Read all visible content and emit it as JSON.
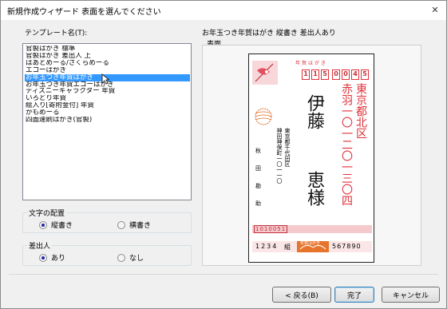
{
  "window": {
    "title": "新規作成ウィザード 表面を選んでください",
    "close_glyph": "✕"
  },
  "templates": {
    "label": "テンプレート名(T):",
    "items": [
      "官製はがき 標準",
      "官製はがき 差出人 上",
      "はあとめーる/さくらめーる",
      "エコーはがき",
      "お年玉つき年賀はがき",
      "お年玉つき年賀エコーはがき",
      "ディズニーキャラクター 年賀",
      "いろどり年賀",
      "絵入り[寄附金付] 年賀",
      "かもめーる",
      "四面連刷はがき(官製)"
    ],
    "selected_index": 4
  },
  "text_layout": {
    "title": "文字の配置",
    "options": [
      "縦書き",
      "横書き"
    ],
    "selected": 0
  },
  "sender": {
    "title": "差出人",
    "options": [
      "あり",
      "なし"
    ],
    "selected": 0
  },
  "preview": {
    "heading": "お年玉つき年賀はがき 縦書き 差出人あり",
    "label": "表面",
    "card": {
      "header": "年賀はがき",
      "postal_code": [
        "1",
        "1",
        "5",
        "0",
        "0",
        "4",
        "5"
      ],
      "address": [
        "東京都北区",
        "赤羽一〇一二〇一三〇四"
      ],
      "recipient": [
        "伊藤",
        "恵様"
      ],
      "sender_address": [
        "東京都千代田区",
        "神田神保町一〇一一〇"
      ],
      "sender_name": [
        "秋",
        "田",
        "勘",
        "助"
      ],
      "sender_postal": "1010051",
      "lottery_left": "1234",
      "lottery_mid": "組",
      "lottery_right": "567890",
      "stamp_text": "年賀はがき"
    }
  },
  "buttons": {
    "back": "< 戻る(B)",
    "finish": "完了",
    "cancel": "キャンセル"
  },
  "colors": {
    "accent": "#e0303a",
    "selection": "#3399ff"
  }
}
